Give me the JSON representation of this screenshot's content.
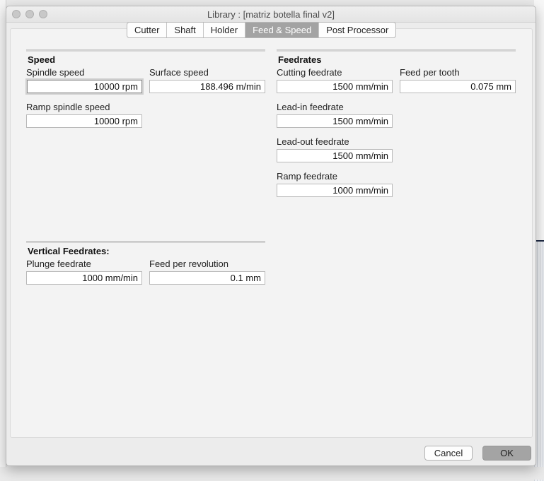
{
  "window": {
    "title": "Library :  [matriz botella final v2]"
  },
  "tabs": [
    {
      "label": "Cutter"
    },
    {
      "label": "Shaft"
    },
    {
      "label": "Holder"
    },
    {
      "label": "Feed & Speed"
    },
    {
      "label": "Post Processor"
    }
  ],
  "speed": {
    "title": "Speed",
    "spindle_speed": {
      "label": "Spindle speed",
      "value": "10000 rpm"
    },
    "surface_speed": {
      "label": "Surface speed",
      "value": "188.496 m/min"
    },
    "ramp_spindle_speed": {
      "label": "Ramp spindle speed",
      "value": "10000 rpm"
    }
  },
  "feedrates": {
    "title": "Feedrates",
    "cutting_feedrate": {
      "label": "Cutting feedrate",
      "value": "1500 mm/min"
    },
    "feed_per_tooth": {
      "label": "Feed per tooth",
      "value": "0.075 mm"
    },
    "lead_in_feedrate": {
      "label": "Lead-in feedrate",
      "value": "1500 mm/min"
    },
    "lead_out_feedrate": {
      "label": "Lead-out feedrate",
      "value": "1500 mm/min"
    },
    "ramp_feedrate": {
      "label": "Ramp feedrate",
      "value": "1000 mm/min"
    }
  },
  "vertical": {
    "title": "Vertical Feedrates:",
    "plunge_feedrate": {
      "label": "Plunge feedrate",
      "value": "1000 mm/min"
    },
    "feed_per_revolution": {
      "label": "Feed per revolution",
      "value": "0.1 mm"
    }
  },
  "buttons": {
    "cancel": "Cancel",
    "ok": "OK"
  }
}
